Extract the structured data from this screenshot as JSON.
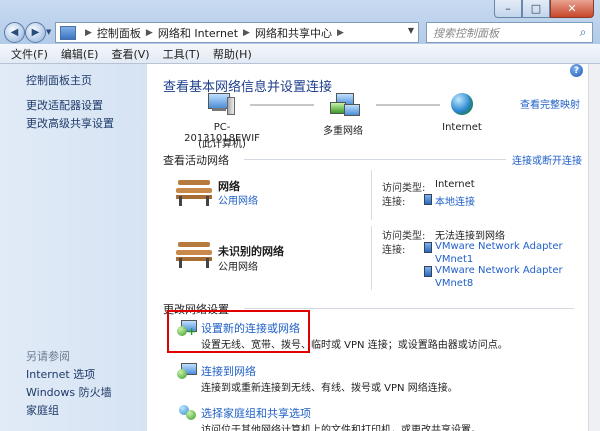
{
  "address": {
    "crumbs": [
      "控制面板",
      "网络和 Internet",
      "网络和共享中心"
    ],
    "search_placeholder": "搜索控制面板"
  },
  "menu": [
    "文件(F)",
    "编辑(E)",
    "查看(V)",
    "工具(T)",
    "帮助(H)"
  ],
  "sidebar": {
    "items": [
      "控制面板主页",
      "更改适配器设置",
      "更改高级共享设置"
    ],
    "see_also_header": "另请参阅",
    "see_also": [
      "Internet 选项",
      "Windows 防火墙",
      "家庭组"
    ]
  },
  "main": {
    "title": "查看基本网络信息并设置连接",
    "view_full_map": "查看完整映射",
    "map": {
      "pc_name": "PC-20131018EWIF",
      "pc_sub": "(此计算机)",
      "middle": "多重网络",
      "right": "Internet"
    },
    "active_header": "查看活动网络",
    "connect_disconnect": "连接或断开连接",
    "networks": [
      {
        "name": "网络",
        "type": "公用网络",
        "access_label": "访问类型:",
        "access_value": "Internet",
        "conn_label": "连接:",
        "conn_value": "本地连接"
      },
      {
        "name": "未识别的网络",
        "type": "公用网络",
        "access_label": "访问类型:",
        "access_value": "无法连接到网络",
        "conn_label": "连接:",
        "adapters": [
          "VMware Network Adapter",
          "VMnet1",
          "VMware Network Adapter",
          "VMnet8"
        ]
      }
    ],
    "change_header": "更改网络设置",
    "tasks": [
      {
        "link": "设置新的连接或网络",
        "desc": "设置无线、宽带、拨号、临时或 VPN 连接；或设置路由器或访问点。"
      },
      {
        "link": "连接到网络",
        "desc": "连接到或重新连接到无线、有线、拨号或 VPN 网络连接。"
      },
      {
        "link": "选择家庭组和共享选项",
        "desc": "访问位于其他网络计算机上的文件和打印机，或更改共享设置。"
      }
    ]
  },
  "colors": {
    "link": "#2060c8",
    "title": "#1e3f8c",
    "highlight": "#e00000"
  }
}
